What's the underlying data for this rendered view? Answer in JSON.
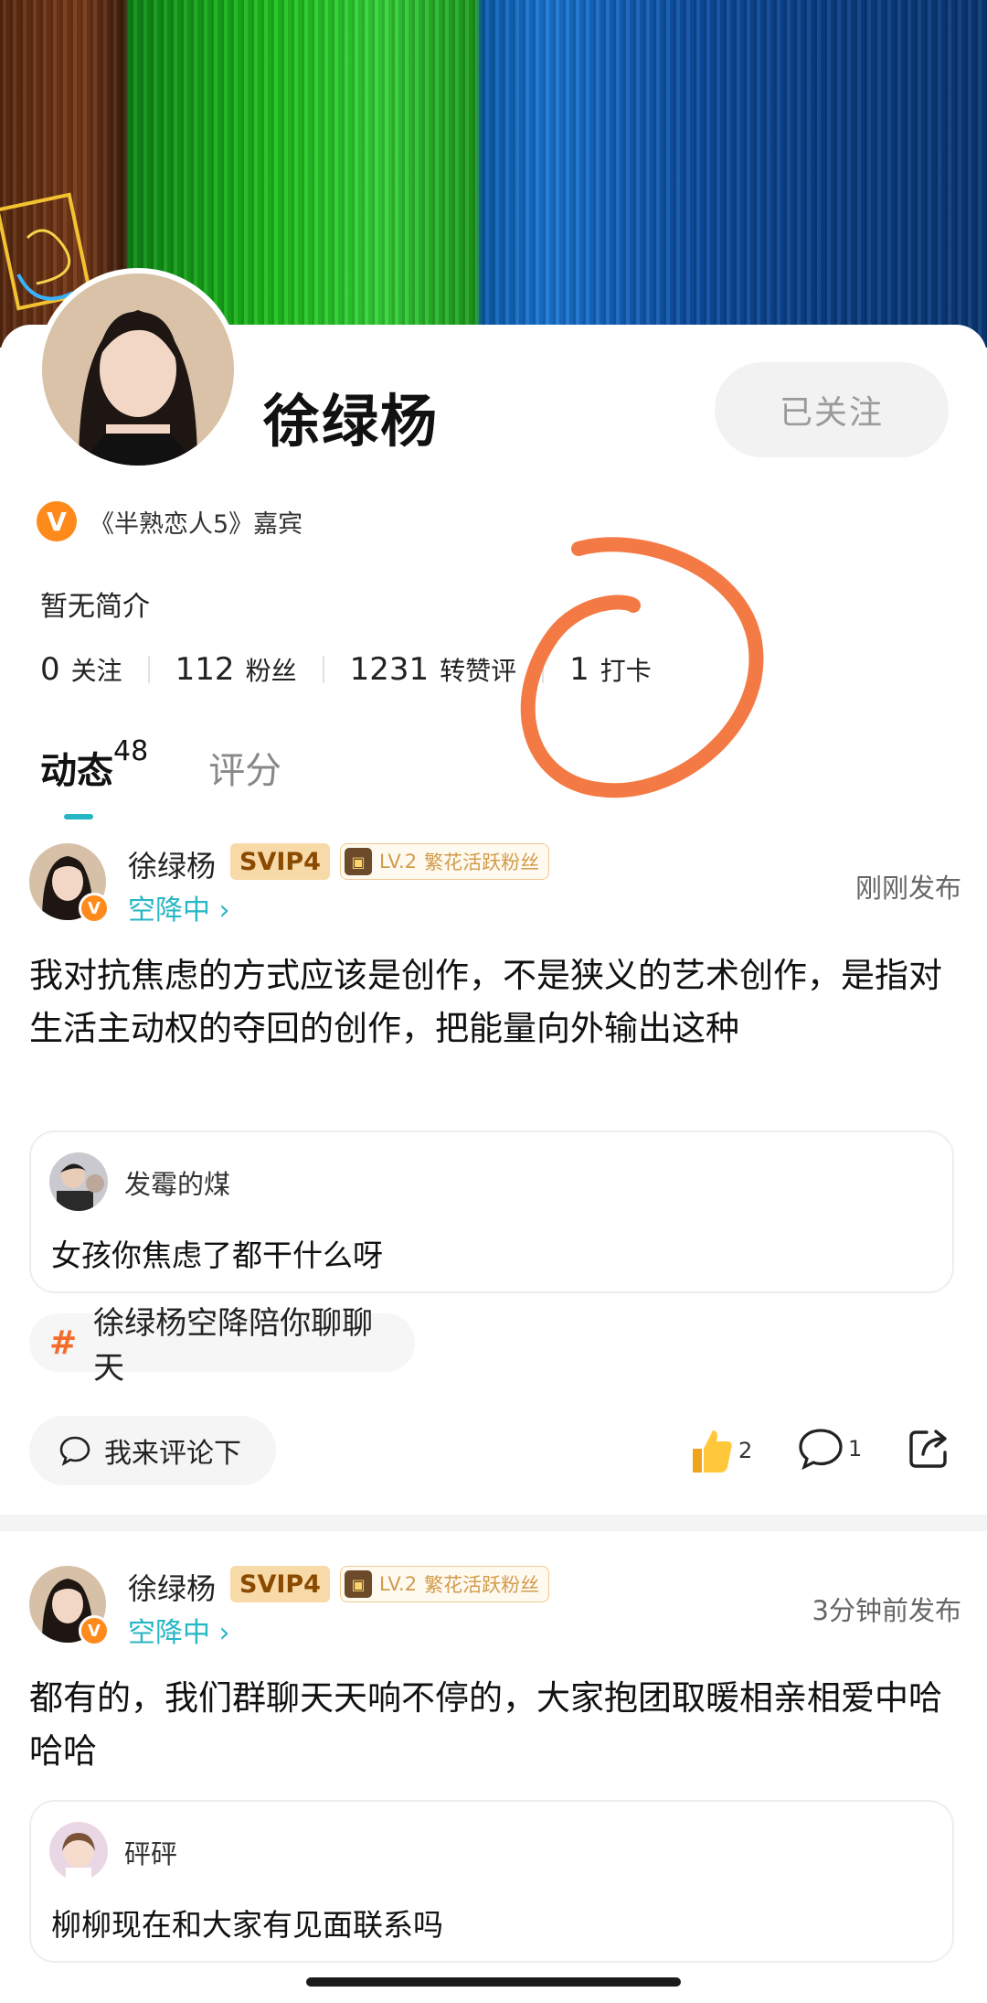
{
  "profile": {
    "name": "徐绿杨",
    "follow_button": "已关注",
    "verified_badge_letter": "V",
    "verified_text": "《半熟恋人5》嘉宾",
    "bio": "暂无简介",
    "stats": [
      {
        "num": "0",
        "label": "关注"
      },
      {
        "num": "112",
        "label": "粉丝"
      },
      {
        "num": "1231",
        "label": "转赞评"
      },
      {
        "num": "1",
        "label": "打卡"
      }
    ],
    "tabs": {
      "active_label": "动态",
      "active_count": "48",
      "other_label": "评分"
    }
  },
  "posts": [
    {
      "author": "徐绿杨",
      "svip": "SVIP4",
      "fan_level": "LV.2",
      "fan_title": "繁花活跃粉丝",
      "status": "空降中 ›",
      "time": "刚刚发布",
      "text": "我对抗焦虑的方式应该是创作，不是狭义的艺术创作，是指对生活主动权的夺回的创作，把能量向外输出这种",
      "comment": {
        "author": "发霉的煤",
        "text": "女孩你焦虑了都干什么呀"
      },
      "topic": "徐绿杨空降陪你聊聊天",
      "comment_button": "我来评论下",
      "likes": "2",
      "comments": "1"
    },
    {
      "author": "徐绿杨",
      "svip": "SVIP4",
      "fan_level": "LV.2",
      "fan_title": "繁花活跃粉丝",
      "status": "空降中 ›",
      "time": "3分钟前发布",
      "text": "都有的，我们群聊天天响不停的，大家抱团取暖相亲相爱中哈哈哈",
      "comment": {
        "author": "砰砰",
        "text": "柳柳现在和大家有见面联系吗"
      }
    }
  ],
  "colors": {
    "accent": "#27b6c4",
    "orange": "#ff8a1c",
    "scribble": "#f47a45"
  }
}
